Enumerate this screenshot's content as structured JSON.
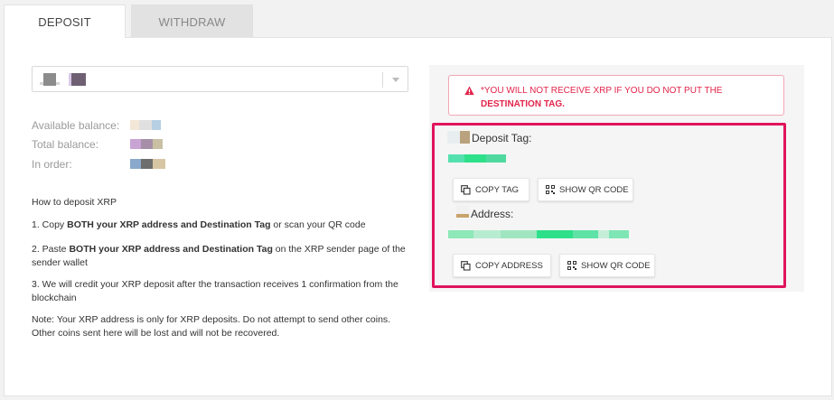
{
  "tabs": [
    {
      "label": "DEPOSIT",
      "active": true
    },
    {
      "label": "WITHDRAW",
      "active": false
    }
  ],
  "balances": {
    "available_label": "Available balance:",
    "total_label": "Total balance:",
    "in_order_label": "In order:"
  },
  "instructions": {
    "heading": "How to deposit XRP",
    "step1_prefix": "1. Copy ",
    "step1_bold": "BOTH your XRP address and Destination Tag",
    "step1_suffix": " or scan your QR code",
    "step2_prefix": "2. Paste ",
    "step2_bold": "BOTH your XRP address and Destination Tag",
    "step2_suffix": " on the XRP sender page of the sender wallet",
    "step3": "3. We will credit your XRP deposit after the transaction receives 1 confirmation from the blockchain",
    "note": "Note: Your XRP address is only for XRP deposits. Do not attempt to send other coins. Other coins sent here will be lost and will not be recovered."
  },
  "warning": {
    "text_prefix": "*YOU WILL NOT RECEIVE XRP IF YOU DO NOT PUT THE ",
    "text_bold": "DESTINATION TAG."
  },
  "deposit_tag": {
    "label": "Deposit Tag:",
    "copy_button": "COPY TAG",
    "qr_button": "SHOW QR CODE"
  },
  "address": {
    "label": "Address:",
    "copy_button": "COPY ADDRESS",
    "qr_button": "SHOW QR CODE"
  },
  "colors": {
    "warning": "#e2244a",
    "highlight_border": "#e0145c",
    "value_green": "#2ee08a"
  }
}
